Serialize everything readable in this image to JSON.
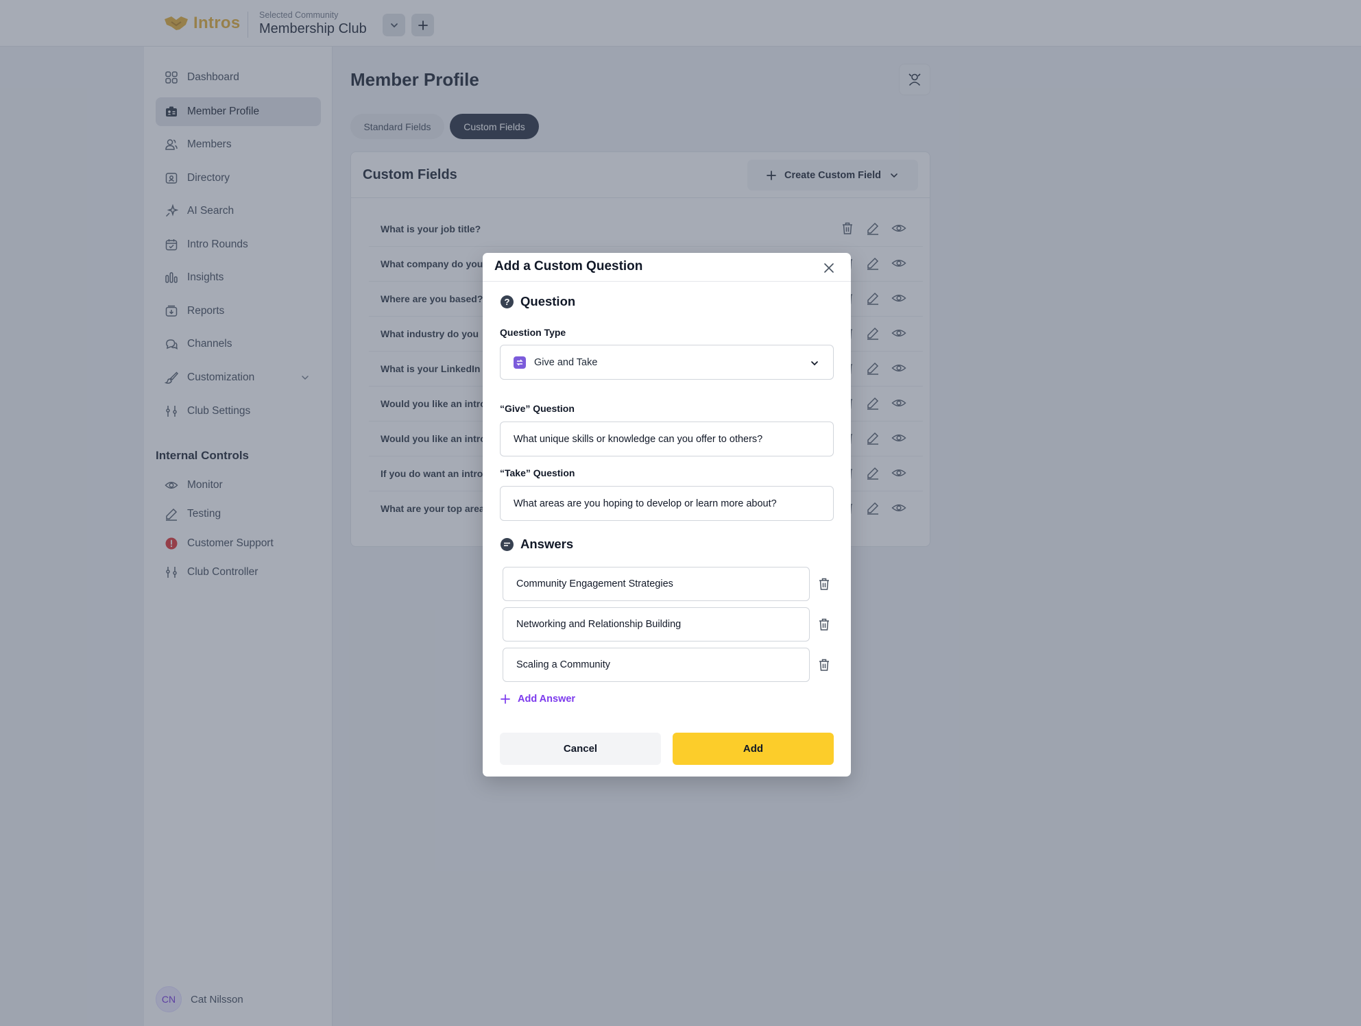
{
  "topbar": {
    "brand": "Intros",
    "community_caption": "Selected Community",
    "community_name": "Membership Club"
  },
  "sidebar": {
    "items": [
      {
        "label": "Dashboard",
        "icon": "dashboard-grid-icon"
      },
      {
        "label": "Member Profile",
        "icon": "id-card-icon",
        "active": true
      },
      {
        "label": "Members",
        "icon": "users-icon"
      },
      {
        "label": "Directory",
        "icon": "directory-icon"
      },
      {
        "label": "AI Search",
        "icon": "sparkle-icon"
      },
      {
        "label": "Intro Rounds",
        "icon": "calendar-icon"
      },
      {
        "label": "Insights",
        "icon": "bar-chart-icon"
      },
      {
        "label": "Reports",
        "icon": "report-icon"
      },
      {
        "label": "Channels",
        "icon": "chat-bubbles-icon"
      },
      {
        "label": "Customization",
        "icon": "paintbrush-icon"
      },
      {
        "label": "Club Settings",
        "icon": "sliders-icon"
      }
    ],
    "internal_title": "Internal Controls",
    "internal_items": [
      {
        "label": "Monitor",
        "icon": "eye-icon"
      },
      {
        "label": "Testing",
        "icon": "pencil-icon"
      },
      {
        "label": "Customer Support",
        "icon": "alert-icon"
      },
      {
        "label": "Club Controller",
        "icon": "sliders-icon"
      }
    ],
    "user": {
      "initials": "CN",
      "name": "Cat Nilsson"
    }
  },
  "main": {
    "title": "Member Profile",
    "tabs": [
      {
        "label": "Standard Fields",
        "active": false
      },
      {
        "label": "Custom Fields",
        "active": true
      }
    ],
    "card_title": "Custom Fields",
    "create_button": "Create Custom Field",
    "fields": [
      "What is your job title?",
      "What company do you",
      "Where are you based?",
      "What industry do you",
      "What is your LinkedIn",
      "Would you like an intro",
      "Would you like an intro",
      "If you do want an intro",
      "What are your top areas"
    ]
  },
  "modal": {
    "title": "Add a Custom Question",
    "question_section": "Question",
    "question_type_label": "Question Type",
    "question_type_value": "Give and Take",
    "give_label": "“Give” Question",
    "give_value": "What unique skills or knowledge can you offer to others?",
    "take_label": "“Take” Question",
    "take_value": "What areas are you hoping to develop or learn more about?",
    "answers_section": "Answers",
    "answers": [
      "Community Engagement Strategies",
      "Networking and Relationship Building",
      "Scaling a Community"
    ],
    "add_answer": "Add Answer",
    "cancel": "Cancel",
    "add": "Add"
  },
  "colors": {
    "brand": "#e1a92b",
    "accent_purple": "#7c3aed",
    "primary_button": "#fccd2a",
    "active_tab": "#1c2536",
    "alert": "#dc2626"
  }
}
